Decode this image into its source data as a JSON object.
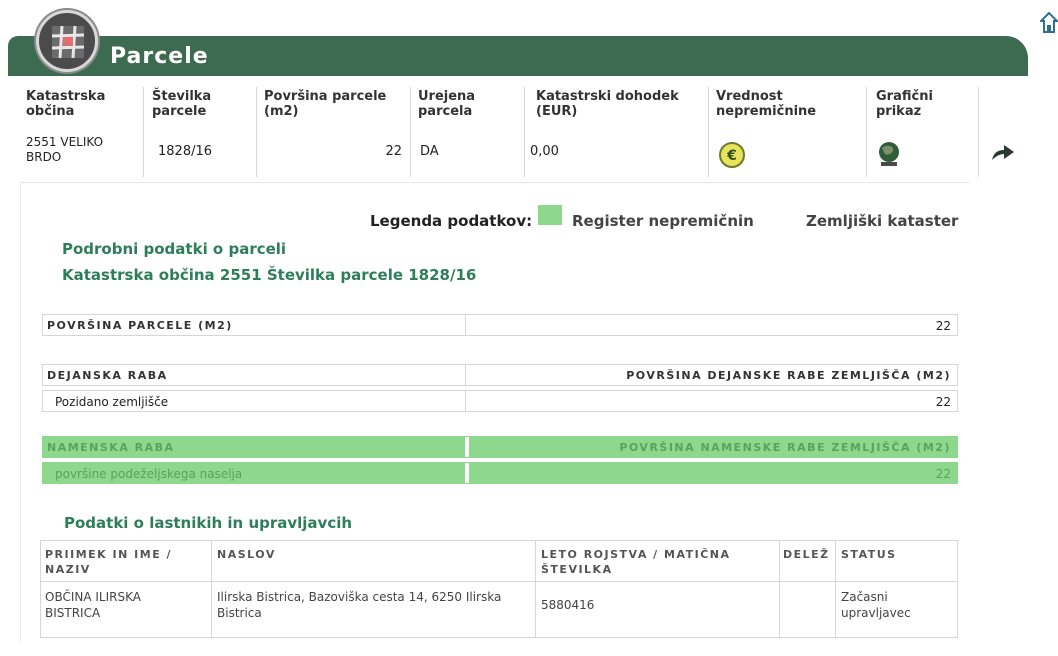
{
  "header": {
    "title": "Parcele",
    "logo_icon": "grid-hash-icon",
    "home_icon": "home-icon",
    "bar_color": "#3d6b52"
  },
  "parcel_table": {
    "columns": [
      "Katastrska občina",
      "Številka parcele",
      "Površina parcele (m2)",
      "Urejena parcela",
      "Katastrski dohodek (EUR)",
      "Vrednost nepremičnine",
      "Grafični prikaz"
    ],
    "row": {
      "kataster": "2551 VELIKO BRDO",
      "parcela": "1828/16",
      "povrsina": "22",
      "urejena": "DA",
      "dohodek": "0,00",
      "vrednost_icon": "euro-coin-icon",
      "graficni_icon": "globe-icon",
      "action_icon": "arrow-up-right-icon"
    }
  },
  "legend": {
    "label": "Legenda podatkov:",
    "register": "Register nepremičnin",
    "kataster": "Zemljiški kataster",
    "register_color": "#8ed88e"
  },
  "detail": {
    "title": "Podrobni podatki o parceli",
    "subtitle": "Katastrska občina 2551 Številka parcele 1828/16",
    "povrsina_label": "POVRŠINA PARCELE (M2)",
    "povrsina_value": "22",
    "raba_label": "DEJANSKA RABA",
    "raba_area_label": "POVRŠINA DEJANSKE RABE ZEMLJIŠČA (M2)",
    "raba_value": "Pozidano zemljišče",
    "raba_area_value": "22",
    "namenska_label": "NAMENSKA RABA",
    "namenska_area_label": "POVRŠINA NAMENSKE RABE ZEMLJIŠČA (M2)",
    "namenska_value": "površine podeželjskega naselja",
    "namenska_area_value": "22"
  },
  "owners": {
    "title": "Podatki o lastnikih in upravljavcih",
    "columns": [
      "PRIIMEK IN IME / NAZIV",
      "NASLOV",
      "LETO ROJSTVA / MATIČNA ŠTEVILKA",
      "DELEŽ",
      "STATUS"
    ],
    "row": {
      "name": "OBČINA ILIRSKA BISTRICA",
      "address": "Ilirska Bistrica, Bazoviška cesta 14, 6250 Ilirska Bistrica",
      "maticna": "5880416",
      "delez": "",
      "status": "Začasni upravljavec"
    }
  }
}
